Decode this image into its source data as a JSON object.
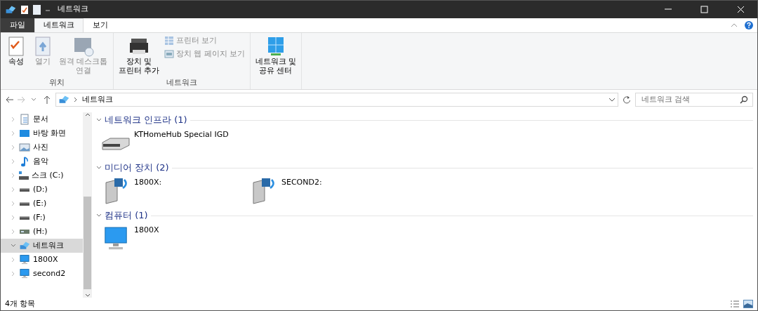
{
  "window": {
    "title": "네트워크"
  },
  "ribbon_tabs": [
    {
      "label": "파일",
      "kind": "file",
      "selected": false
    },
    {
      "label": "네트워크",
      "kind": "tab",
      "selected": true
    },
    {
      "label": "보기",
      "kind": "tab",
      "selected": false
    }
  ],
  "ribbon_groups": [
    {
      "label": "위치",
      "commands": [
        {
          "lines": [
            "속성"
          ],
          "kind": "large",
          "disabled": false
        },
        {
          "lines": [
            "열기"
          ],
          "kind": "large",
          "disabled": true
        },
        {
          "lines": [
            "원격 데스크톱",
            "연결"
          ],
          "kind": "large",
          "disabled": true
        }
      ]
    },
    {
      "label": "네트워크",
      "commands": [
        {
          "lines": [
            "장치 및",
            "프린터 추가"
          ],
          "kind": "large",
          "disabled": false
        },
        {
          "lines": [
            "프린터 보기"
          ],
          "kind": "small",
          "disabled": true
        },
        {
          "lines": [
            "장치 웹 페이지 보기"
          ],
          "kind": "small",
          "disabled": true
        }
      ]
    },
    {
      "commands": [
        {
          "lines": [
            "네트워크 및",
            "공유 센터"
          ],
          "kind": "large",
          "disabled": false
        }
      ]
    }
  ],
  "address": {
    "path": [
      "네트워크"
    ]
  },
  "search": {
    "placeholder": "네트워크 검색"
  },
  "nav": [
    {
      "label": "문서",
      "kind": "documents",
      "selected": false
    },
    {
      "label": "바탕 화면",
      "kind": "desktop",
      "selected": false
    },
    {
      "label": "사진",
      "kind": "pictures",
      "selected": false
    },
    {
      "label": "음악",
      "kind": "music",
      "selected": false
    },
    {
      "label": "스크 (C:)",
      "kind": "system-drive",
      "selected": false
    },
    {
      "label": "(D:)",
      "kind": "drive",
      "selected": false
    },
    {
      "label": "(E:)",
      "kind": "drive",
      "selected": false
    },
    {
      "label": "(F:)",
      "kind": "drive",
      "selected": false
    },
    {
      "label": "(H:)",
      "kind": "usb-drive",
      "selected": false
    },
    {
      "label": "네트워크",
      "kind": "network",
      "selected": true,
      "expanded": true,
      "children": [
        {
          "label": "1800X",
          "kind": "computer",
          "selected": false
        },
        {
          "label": "second2",
          "kind": "computer",
          "selected": false
        }
      ]
    }
  ],
  "groups": [
    {
      "title": "네트워크 인프라 (1)",
      "expanded": true,
      "items": [
        {
          "label": "KTHomeHub Special IGD",
          "kind": "router"
        }
      ]
    },
    {
      "title": "미디어 장치 (2)",
      "expanded": true,
      "items": [
        {
          "label": "1800X:",
          "kind": "media"
        },
        {
          "label": "SECOND2:",
          "kind": "media"
        }
      ]
    },
    {
      "title": "컴퓨터 (1)",
      "expanded": true,
      "items": [
        {
          "label": "1800X",
          "kind": "computer"
        }
      ]
    }
  ],
  "status_bar": {
    "text": "4개 항목"
  }
}
